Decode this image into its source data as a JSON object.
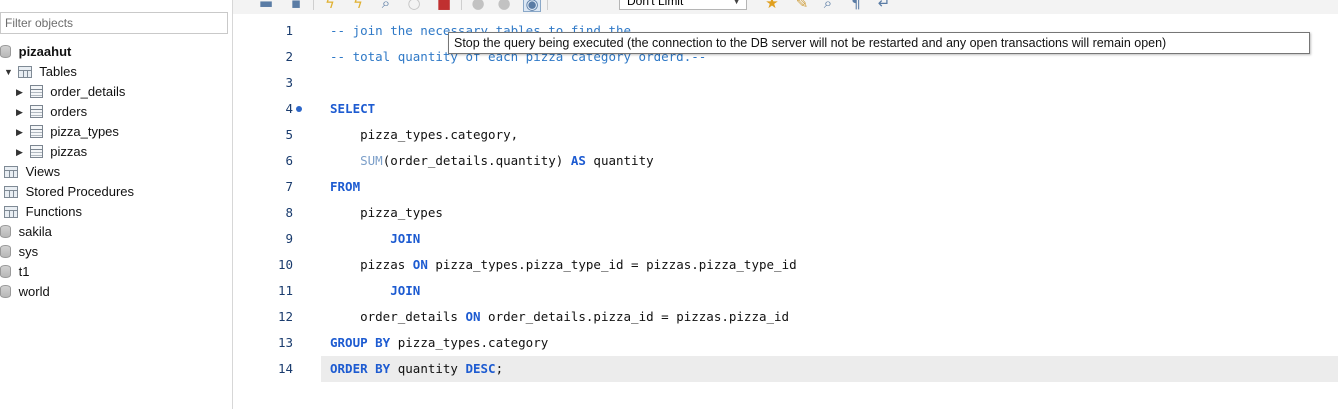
{
  "navigator": {
    "filter_placeholder": "Filter objects",
    "schemas": [
      {
        "name": "pizaahut",
        "expanded": true,
        "children": [
          {
            "label": "Tables",
            "expanded": true,
            "items": [
              "order_details",
              "orders",
              "pizza_types",
              "pizzas"
            ]
          },
          {
            "label": "Views"
          },
          {
            "label": "Stored Procedures"
          },
          {
            "label": "Functions"
          }
        ]
      },
      {
        "name": "sakila"
      },
      {
        "name": "sys"
      },
      {
        "name": "t1"
      },
      {
        "name": "world"
      }
    ]
  },
  "toolbar": {
    "limit_value": "Don't Limit",
    "icons": [
      "open-file-icon",
      "save-icon",
      "execute-icon",
      "execute-current-icon",
      "explain-icon",
      "stop-icon",
      "stop-on-error-icon",
      "commit-icon",
      "rollback-icon",
      "autocommit-icon",
      "beautify-icon",
      "find-icon",
      "invisible-chars-icon",
      "wrap-icon",
      "add-snippet-icon"
    ]
  },
  "tooltip": {
    "text": "Stop the query being executed (the connection to the DB server will not be restarted and any open transactions will remain open)"
  },
  "editor": {
    "current_line": 14,
    "lines": [
      {
        "n": "1",
        "tokens": [
          {
            "t": "-- join the necessary tables to find the",
            "c": "cm"
          }
        ]
      },
      {
        "n": "2",
        "tokens": [
          {
            "t": "-- total quantity of each pizza category orderd.--",
            "c": "cm"
          }
        ]
      },
      {
        "n": "3",
        "tokens": []
      },
      {
        "n": "4",
        "marker": true,
        "tokens": [
          {
            "t": "SELECT",
            "c": "kw"
          }
        ]
      },
      {
        "n": "5",
        "tokens": [
          {
            "t": "    pizza_types.category,",
            "c": ""
          }
        ]
      },
      {
        "n": "6",
        "tokens": [
          {
            "t": "    ",
            "c": ""
          },
          {
            "t": "SUM",
            "c": "fn"
          },
          {
            "t": "(order_details.quantity) ",
            "c": ""
          },
          {
            "t": "AS",
            "c": "kw"
          },
          {
            "t": " quantity",
            "c": ""
          }
        ]
      },
      {
        "n": "7",
        "tokens": [
          {
            "t": "FROM",
            "c": "kw"
          }
        ]
      },
      {
        "n": "8",
        "tokens": [
          {
            "t": "    pizza_types",
            "c": ""
          }
        ]
      },
      {
        "n": "9",
        "tokens": [
          {
            "t": "        ",
            "c": ""
          },
          {
            "t": "JOIN",
            "c": "kw"
          }
        ]
      },
      {
        "n": "10",
        "tokens": [
          {
            "t": "    pizzas ",
            "c": ""
          },
          {
            "t": "ON",
            "c": "kw"
          },
          {
            "t": " pizza_types.pizza_type_id = pizzas.pizza_type_id",
            "c": ""
          }
        ]
      },
      {
        "n": "11",
        "tokens": [
          {
            "t": "        ",
            "c": ""
          },
          {
            "t": "JOIN",
            "c": "kw"
          }
        ]
      },
      {
        "n": "12",
        "tokens": [
          {
            "t": "    order_details ",
            "c": ""
          },
          {
            "t": "ON",
            "c": "kw"
          },
          {
            "t": " order_details.pizza_id = pizzas.pizza_id",
            "c": ""
          }
        ]
      },
      {
        "n": "13",
        "tokens": [
          {
            "t": "GROUP BY",
            "c": "kw"
          },
          {
            "t": " pizza_types.category",
            "c": ""
          }
        ]
      },
      {
        "n": "14",
        "tokens": [
          {
            "t": "ORDER BY",
            "c": "kw"
          },
          {
            "t": " quantity ",
            "c": ""
          },
          {
            "t": "DESC",
            "c": "kw"
          },
          {
            "t": ";",
            "c": ""
          }
        ]
      }
    ]
  }
}
